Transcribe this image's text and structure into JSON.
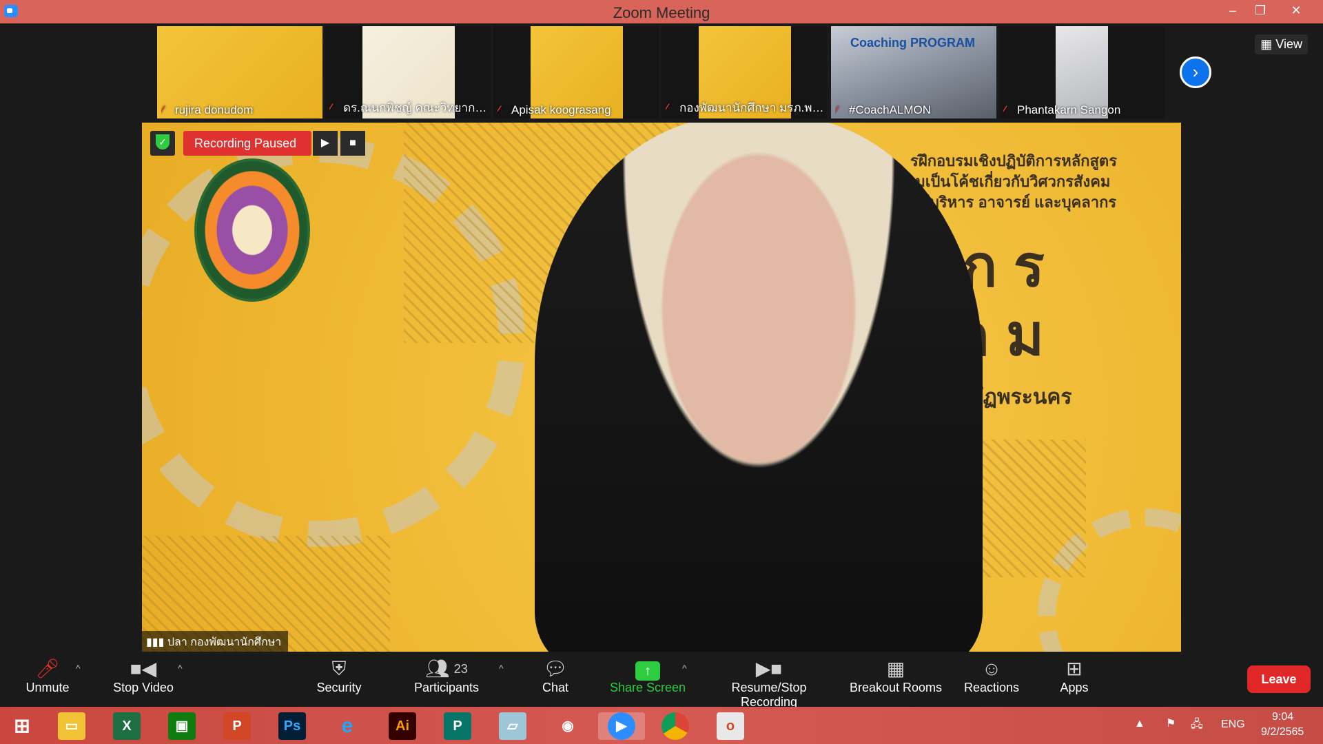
{
  "window": {
    "title": "Zoom Meeting"
  },
  "participants_strip": [
    {
      "name": "rujira donudom"
    },
    {
      "name": "ดร.ณนกพิชญ์ คณะวิทยาการ..."
    },
    {
      "name": "Apisak koograsang"
    },
    {
      "name": "กองพัฒนานักศึกษา มรภ.พร..."
    },
    {
      "name": "#CoachALMON"
    },
    {
      "name": "Phantakarn Sangon"
    }
  ],
  "view_button": "View",
  "recording": {
    "status": "Recording Paused"
  },
  "active_speaker": {
    "name": "ปลา กองพัฒนานักศึกษา"
  },
  "slide_text": {
    "line1": "รฝึกอบรมเชิงปฏิบัติการหลักสูตร",
    "line2": "ามเป็นโค้ชเกี่ยวกับวิศวกรสังคม",
    "line3": "ผู้บริหาร อาจารย์ และบุคลากร",
    "big1": "ว ก ร",
    "big2": "ง ค ม",
    "line4": "ยราชภัฏพระนคร",
    "thumb_banner": "Coaching PROGRAM"
  },
  "toolbar": {
    "unmute": "Unmute",
    "stop_video": "Stop Video",
    "security": "Security",
    "participants": "Participants",
    "participants_count": "23",
    "chat": "Chat",
    "share_screen": "Share Screen",
    "resume_stop_recording": "Resume/Stop Recording",
    "breakout_rooms": "Breakout Rooms",
    "reactions": "Reactions",
    "apps": "Apps",
    "leave": "Leave"
  },
  "taskbar": {
    "language": "ENG",
    "time": "9:04",
    "date": "9/2/2565"
  },
  "colors": {
    "titlebar": "#d9645a",
    "recording": "#e03131",
    "share": "#2ecc40",
    "leave": "#e02828",
    "accent": "#0e72ed"
  }
}
